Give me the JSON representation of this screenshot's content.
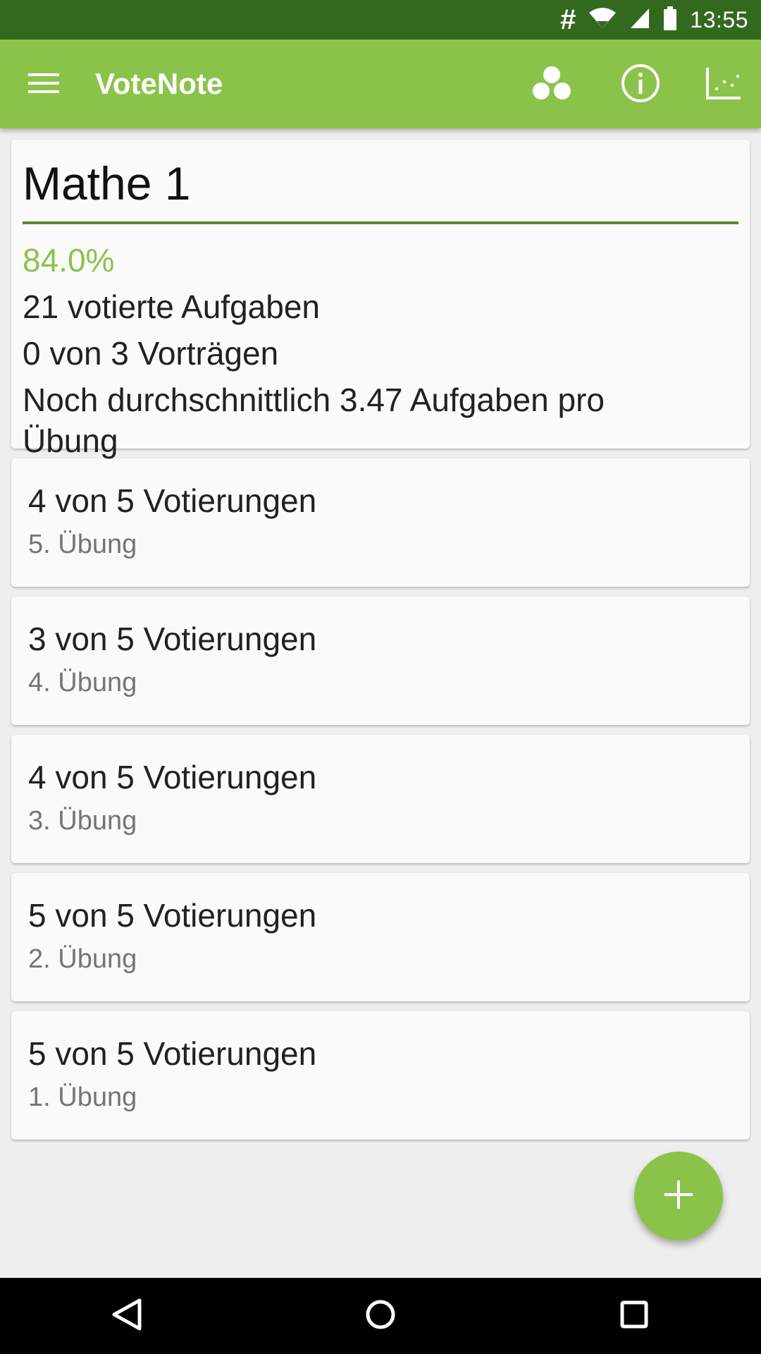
{
  "status_bar": {
    "hash_symbol": "#",
    "time": "13:55",
    "icons": [
      "hash-icon",
      "wifi-icon",
      "signal-icon",
      "battery-icon"
    ]
  },
  "app_bar": {
    "title": "VoteNote",
    "icons": [
      "menu-icon",
      "groups-icon",
      "info-icon",
      "scatter-chart-icon"
    ],
    "color": "#8bc34a"
  },
  "summary": {
    "course_name": "Mathe 1",
    "percentage": "84.0%",
    "voted_tasks": "21 votierte Aufgaben",
    "presentations": "0 von 3 Vorträgen",
    "average_needed": "Noch durchschnittlich 3.47 Aufgaben pro Übung"
  },
  "exercises": [
    {
      "votes": "4 von 5 Votierungen",
      "name": "5. Übung"
    },
    {
      "votes": "3 von 5 Votierungen",
      "name": "4. Übung"
    },
    {
      "votes": "4 von 5 Votierungen",
      "name": "3. Übung"
    },
    {
      "votes": "5 von 5 Votierungen",
      "name": "2. Übung"
    },
    {
      "votes": "5 von 5 Votierungen",
      "name": "1. Übung"
    }
  ],
  "fab": {
    "icon": "plus-icon"
  },
  "nav_bar": {
    "icons": [
      "back-icon",
      "home-icon",
      "recents-icon"
    ]
  },
  "colors": {
    "status_bar": "#33691e",
    "app_bar": "#8bc34a",
    "accent_percent": "#8bc34a",
    "title_underline": "#558b2f"
  }
}
